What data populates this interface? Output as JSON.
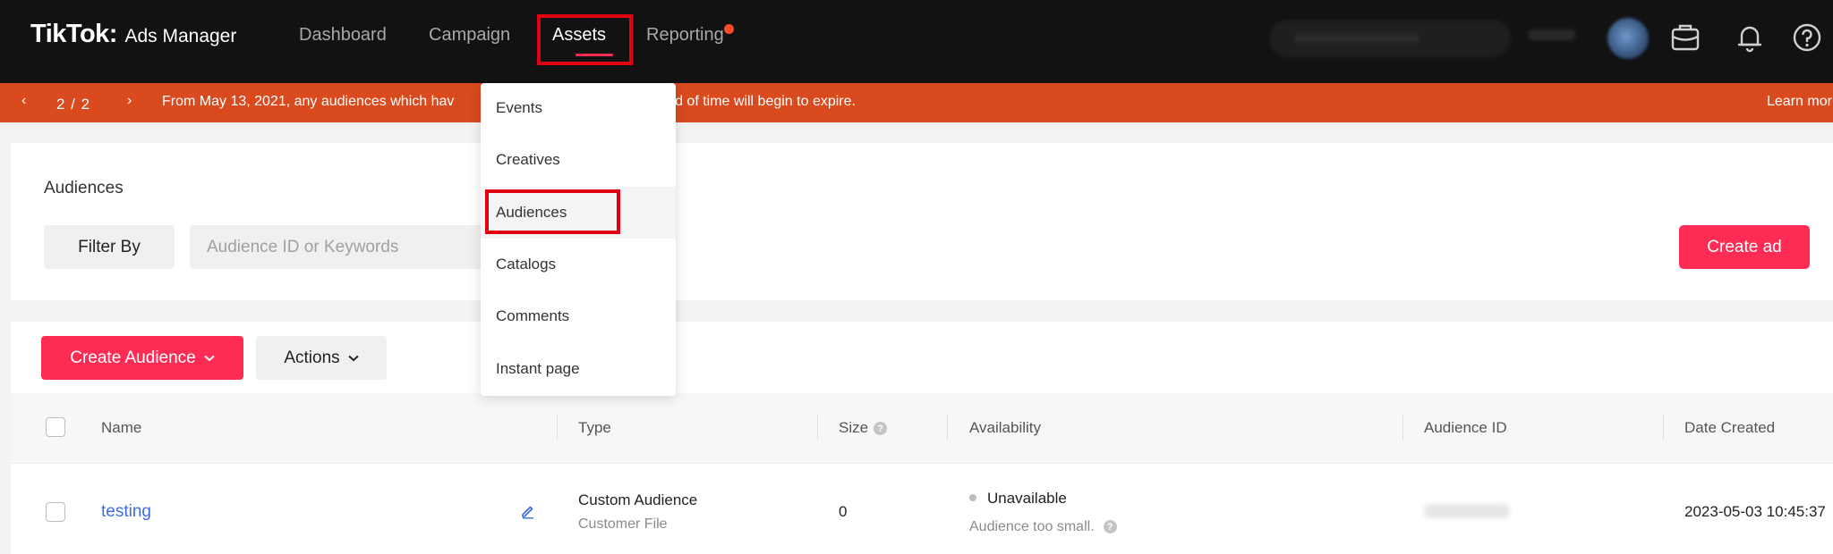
{
  "nav": {
    "brand": "TikTok",
    "brand_sub": "Ads Manager",
    "links": [
      "Dashboard",
      "Campaign",
      "Assets",
      "Reporting"
    ],
    "active": "Assets"
  },
  "banner": {
    "prev": "‹",
    "page": "2 / 2",
    "next": "›",
    "message": "From May 13, 2021, any audiences which have ... period of time will begin to expire.",
    "message_left": "From May 13, 2021, any audiences which hav",
    "message_right": "eriod of time will begin to expire.",
    "learn_more": "Learn mor"
  },
  "filter_card": {
    "title": "Audiences",
    "filter_label": "Filter By",
    "search_placeholder": "Audience ID or Keywords",
    "create_ad": "Create ad"
  },
  "toolbar": {
    "create_audience": "Create Audience",
    "actions": "Actions"
  },
  "table": {
    "headers": {
      "name": "Name",
      "type": "Type",
      "size": "Size",
      "availability": "Availability",
      "audience_id": "Audience ID",
      "date_created": "Date Created"
    },
    "rows": [
      {
        "name": "testing",
        "type": "Custom Audience",
        "subtype": "Customer File",
        "size": "0",
        "availability": "Unavailable",
        "availability_note": "Audience too small.",
        "date_created": "2023-05-03 10:45:37"
      }
    ]
  },
  "dropdown": {
    "items": [
      "Events",
      "Creatives",
      "Audiences",
      "Catalogs",
      "Comments",
      "Instant page"
    ],
    "hovered": "Audiences"
  },
  "colors": {
    "accent": "#fe2c55",
    "banner": "#d94a1e",
    "topbar": "#121212",
    "link": "#3d6de0",
    "highlight_box": "#e00012"
  }
}
